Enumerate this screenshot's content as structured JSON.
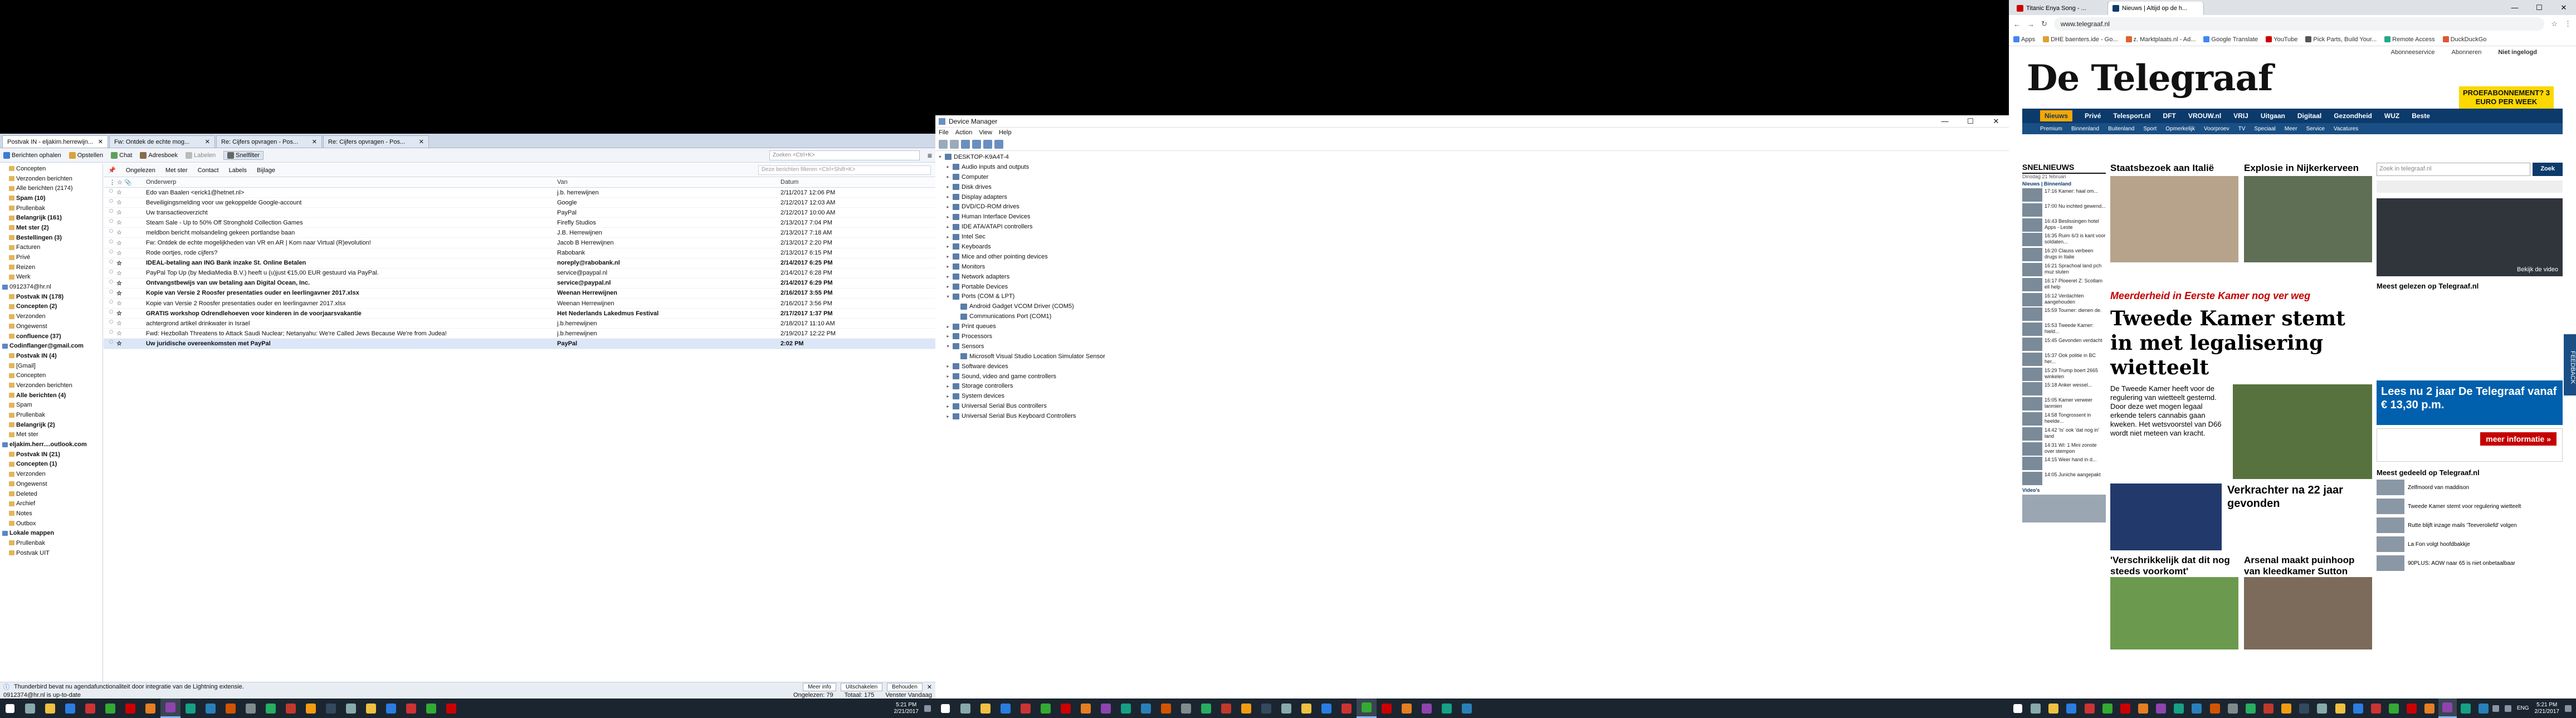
{
  "thunderbird": {
    "tabs": [
      "Postvak IN - eljakim.herrewijn...",
      "Fw: Ontdek de echte mog...",
      "Re: Cijfers opvragen - Pos...",
      "Re: Cijfers opvragen - Pos..."
    ],
    "toolbar": {
      "get": "Berichten ophalen",
      "write": "Opstellen",
      "chat": "Chat",
      "addressbook": "Adresboek",
      "tag": "Labelen",
      "filter": "Snelfilter",
      "search_placeholder": "Zoeken <Ctrl+K>"
    },
    "quickfilter": {
      "unread": "Ongelezen",
      "starred": "Met ster",
      "contact": "Contact",
      "tags": "Labels",
      "attach": "Bijlage",
      "search_placeholder": "Deze berichten filteren <Ctrl+Shift+K>"
    },
    "columns": {
      "subject": "Onderwerp",
      "from": "Van",
      "date": "Datum"
    },
    "folders": [
      {
        "name": "Concepten",
        "b": false,
        "acc": false
      },
      {
        "name": "Verzonden berichten",
        "b": false,
        "acc": false
      },
      {
        "name": "Alle berichten (2174)",
        "b": false,
        "acc": false
      },
      {
        "name": "Spam (10)",
        "b": true,
        "acc": false
      },
      {
        "name": "Prullenbak",
        "b": false,
        "acc": false
      },
      {
        "name": "Belangrijk (161)",
        "b": true,
        "acc": false
      },
      {
        "name": "Met ster (2)",
        "b": true,
        "acc": false
      },
      {
        "name": "Bestellingen (3)",
        "b": true,
        "acc": false
      },
      {
        "name": "Facturen",
        "b": false,
        "acc": false
      },
      {
        "name": "Privé",
        "b": false,
        "acc": false
      },
      {
        "name": "Reizen",
        "b": false,
        "acc": false
      },
      {
        "name": "Werk",
        "b": false,
        "acc": false
      },
      {
        "name": "0912374@hr.nl",
        "b": false,
        "acc": true
      },
      {
        "name": "Postvak IN (178)",
        "b": true,
        "acc": false
      },
      {
        "name": "Concepten (2)",
        "b": true,
        "acc": false
      },
      {
        "name": "Verzonden",
        "b": false,
        "acc": false
      },
      {
        "name": "Ongewenst",
        "b": false,
        "acc": false
      },
      {
        "name": "confluence (37)",
        "b": true,
        "acc": false
      },
      {
        "name": "Codinflanger@gmail.com",
        "b": true,
        "acc": true
      },
      {
        "name": "Postvak IN (4)",
        "b": true,
        "acc": false
      },
      {
        "name": "[Gmail]",
        "b": false,
        "acc": false
      },
      {
        "name": "Concepten",
        "b": false,
        "acc": false
      },
      {
        "name": "Verzonden berichten",
        "b": false,
        "acc": false
      },
      {
        "name": "Alle berichten (4)",
        "b": true,
        "acc": false
      },
      {
        "name": "Spam",
        "b": false,
        "acc": false
      },
      {
        "name": "Prullenbak",
        "b": false,
        "acc": false
      },
      {
        "name": "Belangrijk (2)",
        "b": true,
        "acc": false
      },
      {
        "name": "Met ster",
        "b": false,
        "acc": false
      },
      {
        "name": "eljakim.herr....outlook.com",
        "b": true,
        "acc": true
      },
      {
        "name": "Postvak IN (21)",
        "b": true,
        "acc": false
      },
      {
        "name": "Concepten (1)",
        "b": true,
        "acc": false
      },
      {
        "name": "Verzonden",
        "b": false,
        "acc": false
      },
      {
        "name": "Ongewenst",
        "b": false,
        "acc": false
      },
      {
        "name": "Deleted",
        "b": false,
        "acc": false
      },
      {
        "name": "Archief",
        "b": false,
        "acc": false
      },
      {
        "name": "Notes",
        "b": false,
        "acc": false
      },
      {
        "name": "Outbox",
        "b": false,
        "acc": false
      },
      {
        "name": "Lokale mappen",
        "b": true,
        "acc": true
      },
      {
        "name": "Prullenbak",
        "b": false,
        "acc": false
      },
      {
        "name": "Postvak UIT",
        "b": false,
        "acc": false
      }
    ],
    "messages": [
      {
        "s": "Edo van Baalen <erick1@hetnet.nl>",
        "f": "j.b. herrewijnen",
        "d": "2/11/2017 12:06 PM",
        "u": false
      },
      {
        "s": "Beveiligingsmelding voor uw gekoppelde Google-account",
        "f": "Google",
        "d": "2/12/2017 12:03 AM",
        "u": false
      },
      {
        "s": "Uw transactieoverzicht",
        "f": "PayPal",
        "d": "2/12/2017 10:00 AM",
        "u": false
      },
      {
        "s": "Steam Sale - Up to 50% Off Stronghold Collection Games",
        "f": "Firefly Studios",
        "d": "2/13/2017 7:04 PM",
        "u": false
      },
      {
        "s": "meldbon bericht molsandeling gekeen portlandse baan",
        "f": "J.B. Herrewijnen",
        "d": "2/13/2017 7:18 AM",
        "u": false
      },
      {
        "s": "Fw: Ontdek de echte mogelijkheden van VR en AR | Kom naar Virtual (R)evolution!",
        "f": "Jacob B Herrewijnen",
        "d": "2/13/2017 2:20 PM",
        "u": false
      },
      {
        "s": "Rode oortjes, rode cijfers?",
        "f": "Rabobank",
        "d": "2/13/2017 6:15 PM",
        "u": false
      },
      {
        "s": "IDEAL-betaling aan ING Bank inzake St. Online Betalen",
        "f": "noreply@rabobank.nl",
        "d": "2/14/2017 6:25 PM",
        "u": true
      },
      {
        "s": "PayPal Top Up (by MediaMedia B.V.) heeft u (u)just €15,00 EUR gestuurd via PayPal.",
        "f": "service@paypal.nl",
        "d": "2/14/2017 6:28 PM",
        "u": false
      },
      {
        "s": "Ontvangstbewijs van uw betaling aan Digital Ocean, Inc.",
        "f": "service@paypal.nl",
        "d": "2/14/2017 6:29 PM",
        "u": true
      },
      {
        "s": "Kopie van Versie 2 Roosfer presentaties ouder en leerlingavner 2017.xlsx",
        "f": "Weenan Herrewijnen",
        "d": "2/16/2017 3:55 PM",
        "u": true
      },
      {
        "s": "Kopie van Versie 2 Roosfer presentaties ouder en leerlingavner 2017.xlsx",
        "f": "Weenan Herrewijnen",
        "d": "2/16/2017 3:56 PM",
        "u": false
      },
      {
        "s": "GRATIS workshop Odrendlehoeven voor kinderen in de voorjaarsvakantie",
        "f": "Het Nederlands Lakedmus Festival",
        "d": "2/17/2017 1:37 PM",
        "u": true
      },
      {
        "s": "achtergrond artikel drinkwater in Israel",
        "f": "j.b.herrewijnen",
        "d": "2/18/2017 11:10 AM",
        "u": false
      },
      {
        "s": "Fwd: Hezbollah Threatens to Attack Saudi Nuclear; Netanyahu: We're Called Jews Because We're from Judea!",
        "f": "j.b.herrewijnen",
        "d": "2/19/2017 12:22 PM",
        "u": false
      },
      {
        "s": "Uw juridische overeenkomsten met PayPal",
        "f": "PayPal",
        "d": "2:02 PM",
        "u": true
      }
    ],
    "status": {
      "notice": "Thunderbird bevat nu agendafunctionaliteit door integratie van de Lightning extensie.",
      "more": "Meer info",
      "disable": "Uitschakelen",
      "keep": "Behouden",
      "account": "0912374@hr.nl is up-to-date",
      "unread": "Ongelezen: 79",
      "total": "Totaal: 175",
      "today": "Venster Vandaag"
    }
  },
  "devmgr": {
    "title": "Device Manager",
    "menu": [
      "File",
      "Action",
      "View",
      "Help"
    ],
    "tree": [
      {
        "t": "DESKTOP-K9A4T-4",
        "lvl": 0,
        "ex": "v"
      },
      {
        "t": "Audio inputs and outputs",
        "lvl": 1,
        "ex": ">"
      },
      {
        "t": "Computer",
        "lvl": 1,
        "ex": ">"
      },
      {
        "t": "Disk drives",
        "lvl": 1,
        "ex": ">"
      },
      {
        "t": "Display adapters",
        "lvl": 1,
        "ex": ">"
      },
      {
        "t": "DVD/CD-ROM drives",
        "lvl": 1,
        "ex": ">"
      },
      {
        "t": "Human Interface Devices",
        "lvl": 1,
        "ex": ">"
      },
      {
        "t": "IDE ATA/ATAPI controllers",
        "lvl": 1,
        "ex": ">"
      },
      {
        "t": "Intel Sec",
        "lvl": 1,
        "ex": ">"
      },
      {
        "t": "Keyboards",
        "lvl": 1,
        "ex": ">"
      },
      {
        "t": "Mice and other pointing devices",
        "lvl": 1,
        "ex": ">"
      },
      {
        "t": "Monitors",
        "lvl": 1,
        "ex": ">"
      },
      {
        "t": "Network adapters",
        "lvl": 1,
        "ex": ">"
      },
      {
        "t": "Portable Devices",
        "lvl": 1,
        "ex": ">"
      },
      {
        "t": "Ports (COM & LPT)",
        "lvl": 1,
        "ex": "v"
      },
      {
        "t": "Android Gadget VCOM Driver (COM5)",
        "lvl": 2,
        "ex": ""
      },
      {
        "t": "Communications Port (COM1)",
        "lvl": 2,
        "ex": ""
      },
      {
        "t": "Print queues",
        "lvl": 1,
        "ex": ">"
      },
      {
        "t": "Processors",
        "lvl": 1,
        "ex": ">"
      },
      {
        "t": "Sensors",
        "lvl": 1,
        "ex": "v"
      },
      {
        "t": "Microsoft Visual Studio Location Simulator Sensor",
        "lvl": 2,
        "ex": ""
      },
      {
        "t": "Software devices",
        "lvl": 1,
        "ex": ">"
      },
      {
        "t": "Sound, video and game controllers",
        "lvl": 1,
        "ex": ">"
      },
      {
        "t": "Storage controllers",
        "lvl": 1,
        "ex": ">"
      },
      {
        "t": "System devices",
        "lvl": 1,
        "ex": ">"
      },
      {
        "t": "Universal Serial Bus controllers",
        "lvl": 1,
        "ex": ">"
      },
      {
        "t": "Universal Serial Bus Keyboard Controllers",
        "lvl": 1,
        "ex": ">"
      }
    ]
  },
  "browser": {
    "tabs": [
      "Titanic Enya Song - ...",
      "Nieuws | Altijd op de h...",
      ""
    ],
    "url": "www.telegraaf.nl",
    "bookmarks": [
      "Apps",
      "DHE baenters.ide - Go...",
      "z. Marktplaats.nl - Ad...",
      "Google Translate",
      "YouTube",
      "Pick Parts, Build Your...",
      "Remote Access",
      "DuckDuckGo"
    ],
    "topbar": [
      "Abonneeservice",
      "Abonneren",
      "Niet ingelogd"
    ],
    "logo": "De Telegraaf",
    "promo": "PROEFABONNEMENT? 3 EURO PER WEEK",
    "nav": [
      "Nieuws",
      "Privé",
      "Telesport.nl",
      "DFT",
      "VROUW.nl",
      "VRIJ",
      "Uitgaan",
      "Digitaal",
      "Gezondheid",
      "WUZ",
      "Beste"
    ],
    "subnav": [
      "Premium",
      "Binnenland",
      "Buitenland",
      "Sport",
      "Opmerkelijk",
      "Voorproev",
      "TV",
      "Speciaal",
      "Meer",
      "Service",
      "Vacatures"
    ],
    "snelnieuws": {
      "title": "SNELNIEUWS",
      "date": "Dinsdag 21 februari",
      "head": "Nieuws | Binnenland",
      "items": [
        "17:16 Kamer: haal om...",
        "17:00 Nu inchted gewend...",
        "16:43 Beslissingen hotel Apps - Leste",
        "16:35 Ruim 6/3 is kant voor soldaten...",
        "16:20 Clauss verbeen drugs in Italie",
        "16:21 Sprachoal land pch muz sluten",
        "16:17 Ploeeret Z: Scotlam ell help",
        "16:12 Verdachten aangehouden",
        "15:59 Tourner: dienen de.",
        "15:53 Tweede Kamer: hield...",
        "15:45 Gevonden verdacht",
        "15:37 Ook politie in BC her...",
        "15:29 Trump boert 2665 winkelen",
        "15:18 Anker wessel...",
        "15:05 Kamer verweer lanmien",
        "14:58 Tongrossent in heelde...",
        "14:42 'Is' ook 'dat nog in' land",
        "14:31 Wi: 1 Mini zonste over stempon",
        "14:15 Weer hand in d...",
        "14:05 Juniche aangepakt"
      ],
      "video": "Video's"
    },
    "mid": {
      "a1": "Staatsbezoek aan Italië",
      "a2": "Explosie in Nijkerkerveen",
      "kicker": "Meerderheid in Eerste Kamer nog ver weg",
      "head": "Tweede Kamer stemt in met legalisering wietteelt",
      "body": "De Tweede Kamer heeft voor de regulering van wietteelt gestemd. Door deze wet mogen legaal erkende telers cannabis gaan kweken. Het wetsvoorstel van D66 wordt niet meteen van kracht.",
      "a3": "Verkrachter na 22 jaar gevonden",
      "a4": "'Verschrikkelijk dat dit nog steeds voorkomt'",
      "a5": "Arsenal maakt puinhoop van kleedkamer Sutton"
    },
    "right": {
      "search_placeholder": "Zoek in telegraaf.nl",
      "search_btn": "Zoek",
      "video": "Bekijk de video",
      "meest": "Meest gelezen op Telegraaf.nl",
      "meest2": "Meest gedeeld op Telegraaf.nl",
      "items": [
        "Zelfmoord van maddison",
        "Tweede Kamer stemt voor regulering wietteelt",
        "Rutte blijft inzage mails 'Teeveroliefd' volgen",
        "La Fon volgt hoofdbakkje",
        "90PLUS: AOW naar 65 is niet onbetaalbaar"
      ],
      "ad1": "Lees nu 2 jaar De Telegraaf vanaf € 13,30 p.m.",
      "ad2": "meer informatie »"
    },
    "feedback": "FEEDBACK"
  },
  "taskbars": {
    "t1": {
      "time": "5:21 PM",
      "date": "2/21/2017"
    },
    "t3": {
      "time": "5:21 PM",
      "date": "2/21/2017",
      "lang": "ENG"
    }
  },
  "colors": {
    "tg_blue": "#0b3a6b",
    "tg_yellow": "#fcd800",
    "tb_tab": "#cfd9e8",
    "taskbar": "#1b2530"
  }
}
